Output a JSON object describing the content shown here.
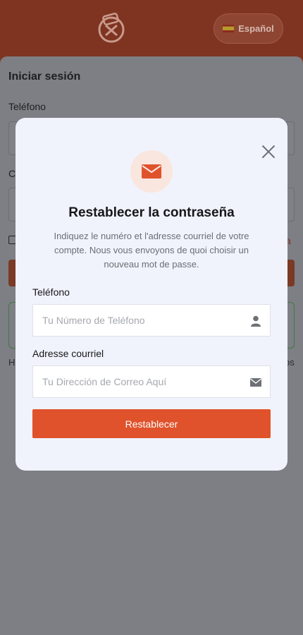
{
  "header": {
    "language_label": "Español",
    "language_flag": "spain-flag-icon"
  },
  "background_form": {
    "title": "Iniciar sesión",
    "phone_label": "Teléfono",
    "second_label_fragment": "C",
    "link_fragment": "a",
    "footer_left_fragment": "H",
    "footer_right_fragment": "os"
  },
  "modal": {
    "title": "Restablecer la contraseña",
    "description": "Indiquez le numéro et l'adresse courriel de votre compte. Nous vous envoyons de quoi choisir un nouveau mot de passe.",
    "phone": {
      "label": "Teléfono",
      "placeholder": "Tu Número de Teléfono",
      "value": ""
    },
    "email": {
      "label": "Adresse courriel",
      "placeholder": "Tu Dirección de Correo Aquí",
      "value": ""
    },
    "submit_label": "Restablecer"
  },
  "colors": {
    "accent": "#e0522b",
    "modal_bg": "#f0f3fb",
    "overlay": "#7a7c80"
  }
}
